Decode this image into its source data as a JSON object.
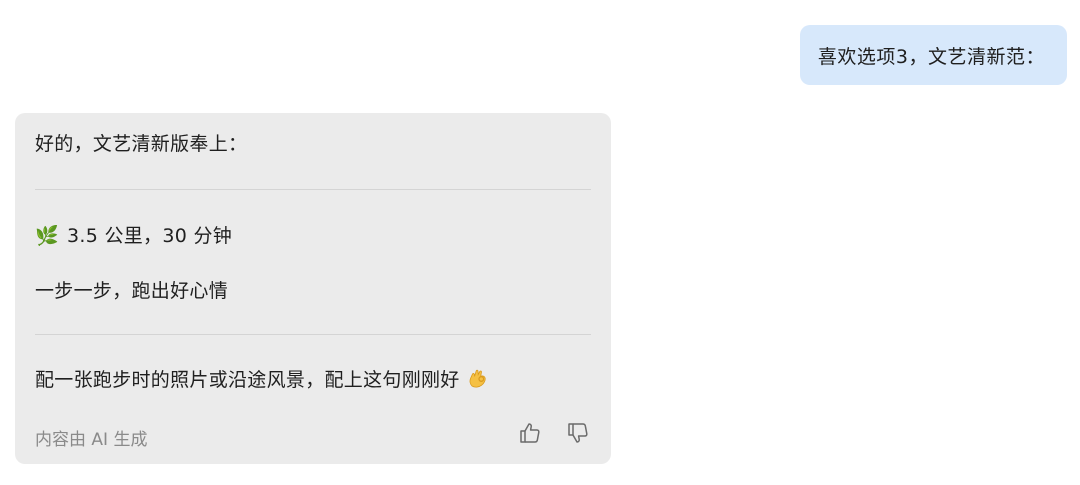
{
  "conversation": {
    "user_message": "喜欢选项3，文艺清新范：",
    "ai_reply": {
      "intro": "好的，文艺清新版奉上：",
      "stat_emoji": "🌿",
      "stat_text": "3.5 公里，30 分钟",
      "slogan": "一步一步，跑出好心情",
      "tip": "配一张跑步时的照片或沿途风景，配上这句刚刚好",
      "tip_emoji": "ok-hand-icon",
      "ai_note": "内容由 AI 生成",
      "actions": {
        "like": "thumbs-up-icon",
        "dislike": "thumbs-down-icon"
      }
    }
  },
  "colors": {
    "user_bubble": "#d7e8fb",
    "ai_card": "#ebebeb",
    "muted_text": "#8a8a8a",
    "divider": "#d4d4d4"
  }
}
